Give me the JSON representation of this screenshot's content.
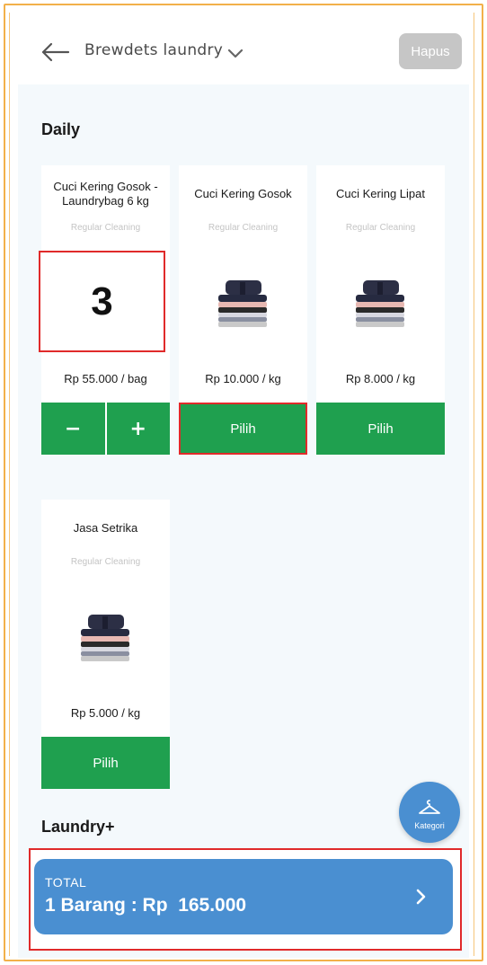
{
  "header": {
    "store_name": "Brewdets laundry",
    "delete_label": "Hapus"
  },
  "sections": {
    "daily": "Daily",
    "laundry_plus": "Laundry+"
  },
  "products": [
    {
      "name": "Cuci Kering Gosok - Laundrybag 6 kg",
      "subtitle": "Regular Cleaning",
      "price": "Rp 55.000 / bag",
      "quantity": "3",
      "minus_label": "−",
      "plus_label": "+"
    },
    {
      "name": "Cuci Kering Gosok",
      "subtitle": "Regular Cleaning",
      "price": "Rp 10.000 / kg",
      "action_label": "Pilih"
    },
    {
      "name": "Cuci Kering Lipat",
      "subtitle": "Regular Cleaning",
      "price": "Rp 8.000 / kg",
      "action_label": "Pilih"
    },
    {
      "name": "Jasa Setrika",
      "subtitle": "Regular Cleaning",
      "price": "Rp 5.000 / kg",
      "action_label": "Pilih"
    }
  ],
  "fab": {
    "label": "Kategori",
    "icon": "hanger-icon"
  },
  "total": {
    "label": "TOTAL",
    "amount": "1 Barang : Rp  165.000"
  },
  "colors": {
    "green": "#1fa04f",
    "blue": "#4a8fd1",
    "red_outline": "#e02a2a",
    "frame_orange": "#f2b04a"
  }
}
